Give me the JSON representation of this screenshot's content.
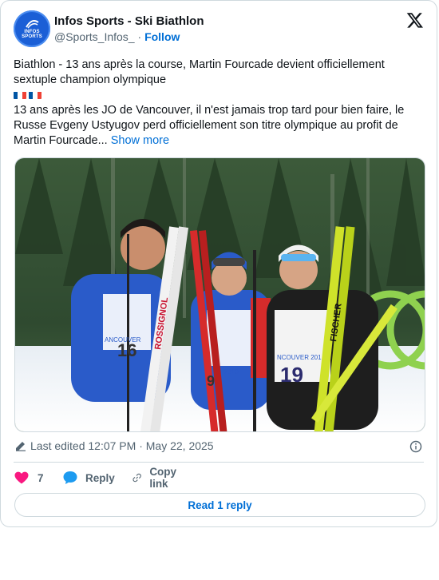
{
  "author": {
    "name": "Infos Sports - Ski Biathlon",
    "handle": "@Sports_Infos_",
    "separator": "·",
    "follow_label": "Follow",
    "avatar_text_1": "INFOS",
    "avatar_text_2": "SPORTS"
  },
  "post": {
    "paragraph_1": "Biathlon - 13 ans après la course, Martin Fourcade devient officiellement sextuple champion olympique",
    "paragraph_2": "13 ans après les JO de Vancouver, il n'est jamais trop tard pour bien faire, le Russe Evgeny Ustyugov perd officiellement son titre olympique au profit de Martin Fourcade...",
    "show_more": "Show more",
    "flags": [
      "french-flag",
      "french-flag"
    ]
  },
  "photo": {
    "bibs": [
      "16",
      "9",
      "19"
    ],
    "ski_brand_1": "ROSSIGNOL",
    "ski_brand_2": "FISCHER",
    "bib_text_left": "ANCOUVER",
    "bib_text_mid": "2010",
    "bib_text_right": "NCOUVER 201"
  },
  "meta": {
    "edited_text": "Last edited 12:07 PM · May 22, 2025"
  },
  "actions": {
    "like_count": "7",
    "reply_label": "Reply",
    "copy_label": "Copy link",
    "read_replies_label": "Read 1 reply"
  },
  "colors": {
    "accent": "#006fd6",
    "like": "#f91880",
    "reply_icon": "#1d9bf0",
    "text_secondary": "#536471",
    "border": "#cfd9de"
  }
}
